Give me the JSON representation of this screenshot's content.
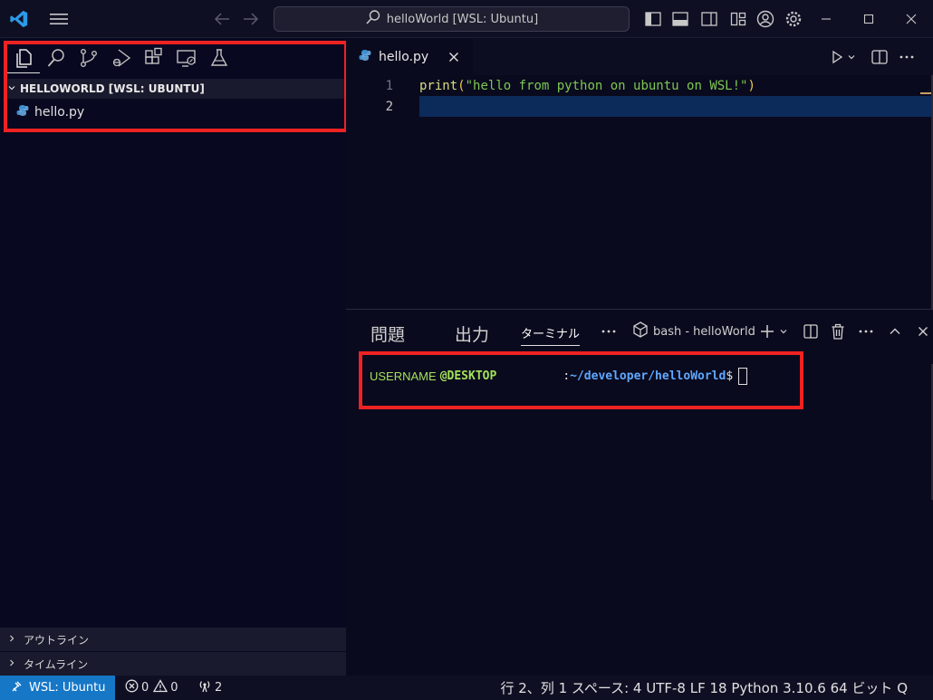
{
  "titlebar": {
    "search_text": "helloWorld [WSL: Ubuntu]"
  },
  "sidebar": {
    "activity_icons": [
      "files-icon",
      "search-icon",
      "source-control-icon",
      "run-debug-icon",
      "extensions-icon",
      "remote-explorer-icon",
      "testing-icon"
    ],
    "explorer_title": "HELLOWORLD [WSL: UBUNTU]",
    "files": [
      {
        "name": "hello.py"
      }
    ],
    "outline_label": "アウトライン",
    "timeline_label": "タイムライン"
  },
  "editor": {
    "tab_label": "hello.py",
    "lines": [
      {
        "no": "1",
        "fn": "print",
        "open": "(",
        "str": "\"hello from python on ubuntu on WSL!\"",
        "close": ")"
      },
      {
        "no": "2"
      }
    ]
  },
  "panel": {
    "tabs": [
      "問題",
      "出力",
      "ターミナル"
    ],
    "terminal_name": "bash - helloWorld",
    "terminal": {
      "user": "USERNAME",
      "host": "@DESKTOP",
      "sep": ":",
      "path": "~/developer/helloWorld",
      "dollar": "$"
    }
  },
  "statusbar": {
    "remote": "WSL: Ubuntu",
    "errors": "0",
    "warnings": "0",
    "ports": "2",
    "right": "行 2、列 1 スペース: 4 UTF-8 LF 18 Python 3.10.6 64 ビット Q"
  },
  "colors": {
    "accent": "#1677c7",
    "highlight_box": "#ee2222",
    "string": "#7ec850",
    "keyword_fn": "#dcdc82",
    "path": "#5fa8ff"
  }
}
